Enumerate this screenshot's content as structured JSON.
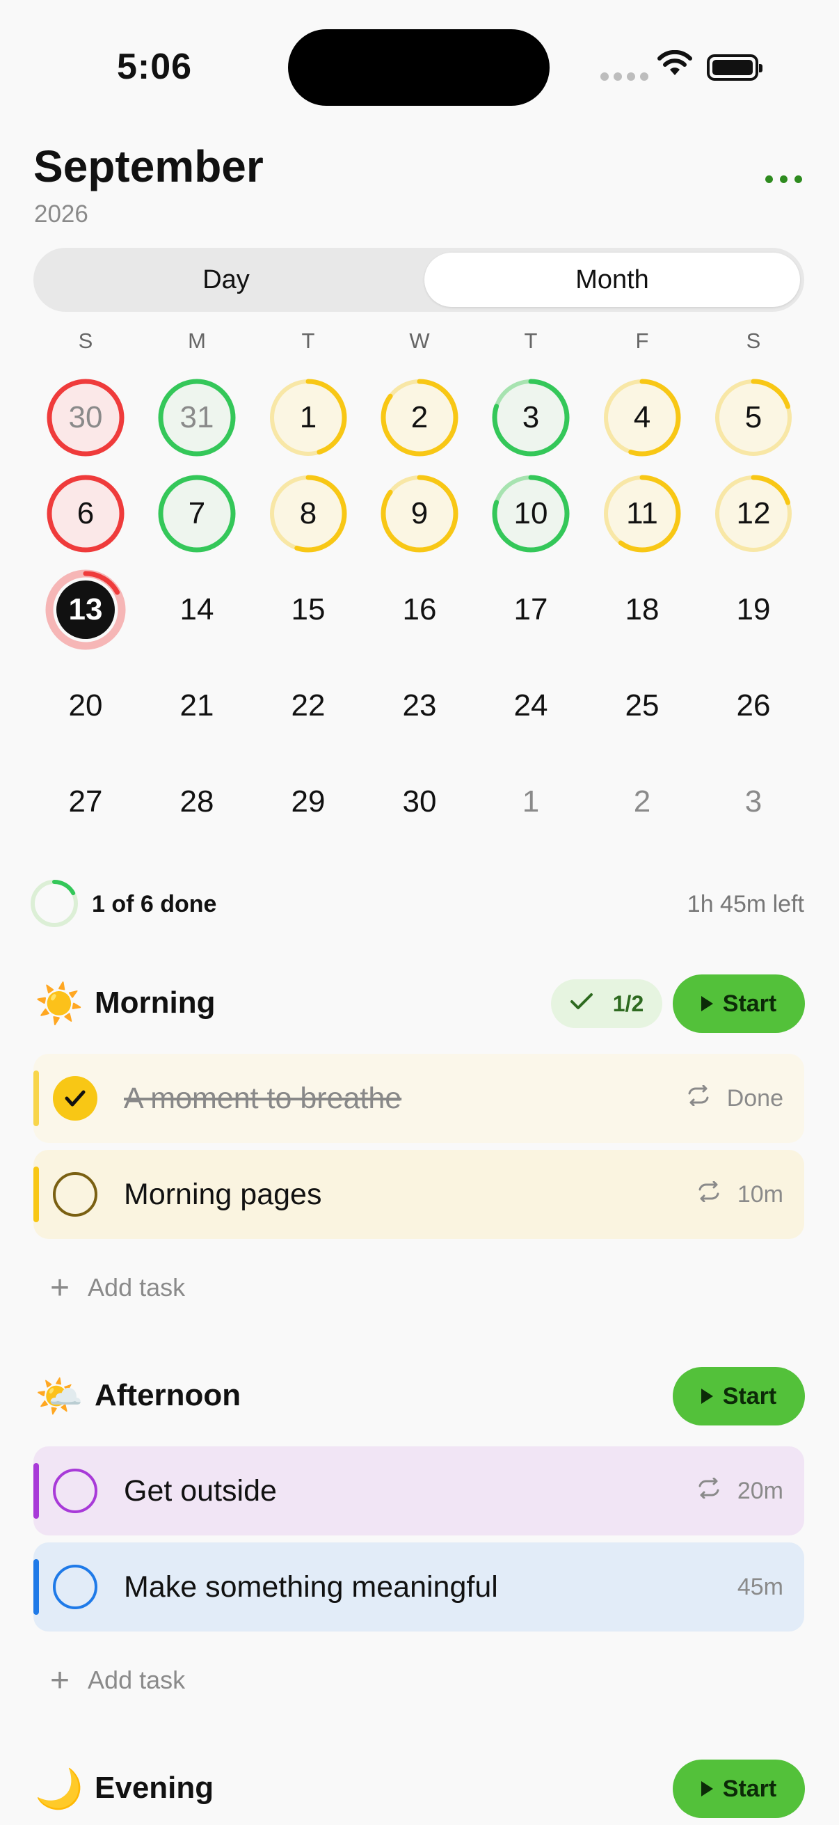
{
  "status_bar": {
    "time": "5:06"
  },
  "header": {
    "month": "September",
    "year": "2026"
  },
  "view_toggle": {
    "day": "Day",
    "month": "Month",
    "selected": "Month"
  },
  "weekdays": [
    "S",
    "M",
    "T",
    "W",
    "T",
    "F",
    "S"
  ],
  "calendar": {
    "weeks": [
      [
        {
          "n": "30",
          "muted": true,
          "status": "missed",
          "progress": 1.0
        },
        {
          "n": "31",
          "muted": true,
          "status": "complete",
          "progress": 1.0
        },
        {
          "n": "1",
          "status": "partial",
          "progress": 0.45
        },
        {
          "n": "2",
          "status": "partial",
          "progress": 0.85
        },
        {
          "n": "3",
          "status": "complete",
          "progress": 0.8
        },
        {
          "n": "4",
          "status": "partial",
          "progress": 0.55
        },
        {
          "n": "5",
          "status": "partial",
          "progress": 0.2
        }
      ],
      [
        {
          "n": "6",
          "status": "missed",
          "progress": 1.0
        },
        {
          "n": "7",
          "status": "complete",
          "progress": 1.0
        },
        {
          "n": "8",
          "status": "partial",
          "progress": 0.55
        },
        {
          "n": "9",
          "status": "partial",
          "progress": 0.85
        },
        {
          "n": "10",
          "status": "complete",
          "progress": 0.8
        },
        {
          "n": "11",
          "status": "partial",
          "progress": 0.6
        },
        {
          "n": "12",
          "status": "partial",
          "progress": 0.2
        }
      ],
      [
        {
          "n": "13",
          "status": "today",
          "progress": 0.17
        },
        {
          "n": "14"
        },
        {
          "n": "15"
        },
        {
          "n": "16"
        },
        {
          "n": "17"
        },
        {
          "n": "18"
        },
        {
          "n": "19"
        }
      ],
      [
        {
          "n": "20"
        },
        {
          "n": "21"
        },
        {
          "n": "22"
        },
        {
          "n": "23"
        },
        {
          "n": "24"
        },
        {
          "n": "25"
        },
        {
          "n": "26"
        }
      ],
      [
        {
          "n": "27"
        },
        {
          "n": "28"
        },
        {
          "n": "29"
        },
        {
          "n": "30"
        },
        {
          "n": "1",
          "muted": true
        },
        {
          "n": "2",
          "muted": true
        },
        {
          "n": "3",
          "muted": true
        }
      ]
    ]
  },
  "summary": {
    "done_text": "1 of 6 done",
    "left_text": "1h 45m left",
    "progress": 0.17
  },
  "colors": {
    "accent_green": "#53c13a",
    "yellow": "#f8c715",
    "green": "#34c759",
    "red": "#ef3b3b",
    "purple": "#a83ad8",
    "blue": "#1f7ae8"
  },
  "sections": {
    "morning": {
      "icon": "☀️",
      "title": "Morning",
      "progress": "1/2",
      "start": "Start",
      "tasks": [
        {
          "label": "A moment to breathe",
          "meta": "Done",
          "done": true
        },
        {
          "label": "Morning pages",
          "meta": "10m",
          "done": false
        }
      ],
      "add": "Add task"
    },
    "afternoon": {
      "icon": "🌤️",
      "title": "Afternoon",
      "start": "Start",
      "tasks": [
        {
          "label": "Get outside",
          "meta": "20m"
        },
        {
          "label": "Make something meaningful",
          "meta": "45m"
        }
      ],
      "add": "Add task"
    },
    "evening": {
      "icon": "🌙",
      "title": "Evening",
      "start": "Start"
    }
  }
}
